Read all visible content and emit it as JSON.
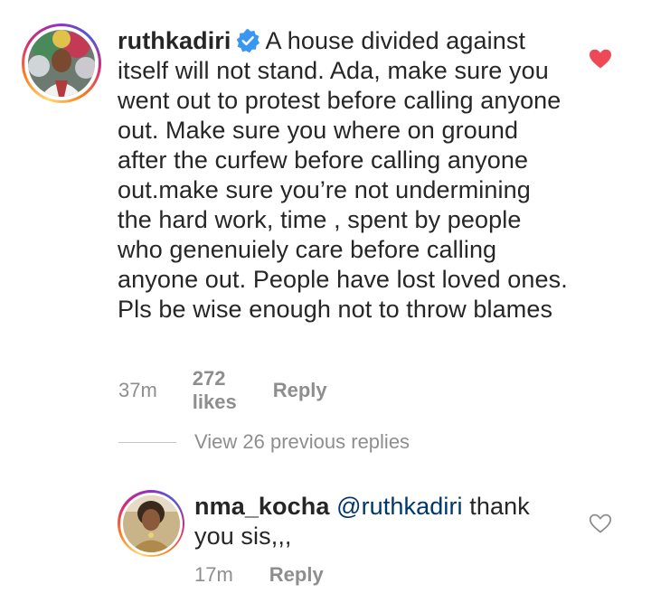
{
  "colors": {
    "text": "#262626",
    "muted": "#8e8e8e",
    "mention": "#00376b",
    "verified": "#3897f0",
    "like_red": "#ed4956"
  },
  "comment1": {
    "username": "ruthkadiri",
    "verified": true,
    "text": "A house divided against itself will not stand. Ada, make sure you went out to protest before calling anyone out. Make sure you where on ground after the curfew before calling anyone out.make sure you’re not undermining the hard work, time , spent by people who genenuiely care before calling anyone out.  People have lost loved ones. Pls be wise enough not to throw blames",
    "time": "37m",
    "likes": "272 likes",
    "reply_label": "Reply",
    "liked": true,
    "like_icon": "heart-filled-icon"
  },
  "view_replies_label": "View 26 previous replies",
  "reply1": {
    "username": "nma_kocha",
    "mention": "@ruthkadiri",
    "text": "thank you sis,,,",
    "time": "17m",
    "reply_label": "Reply",
    "liked": false,
    "like_icon": "heart-outline-icon"
  }
}
